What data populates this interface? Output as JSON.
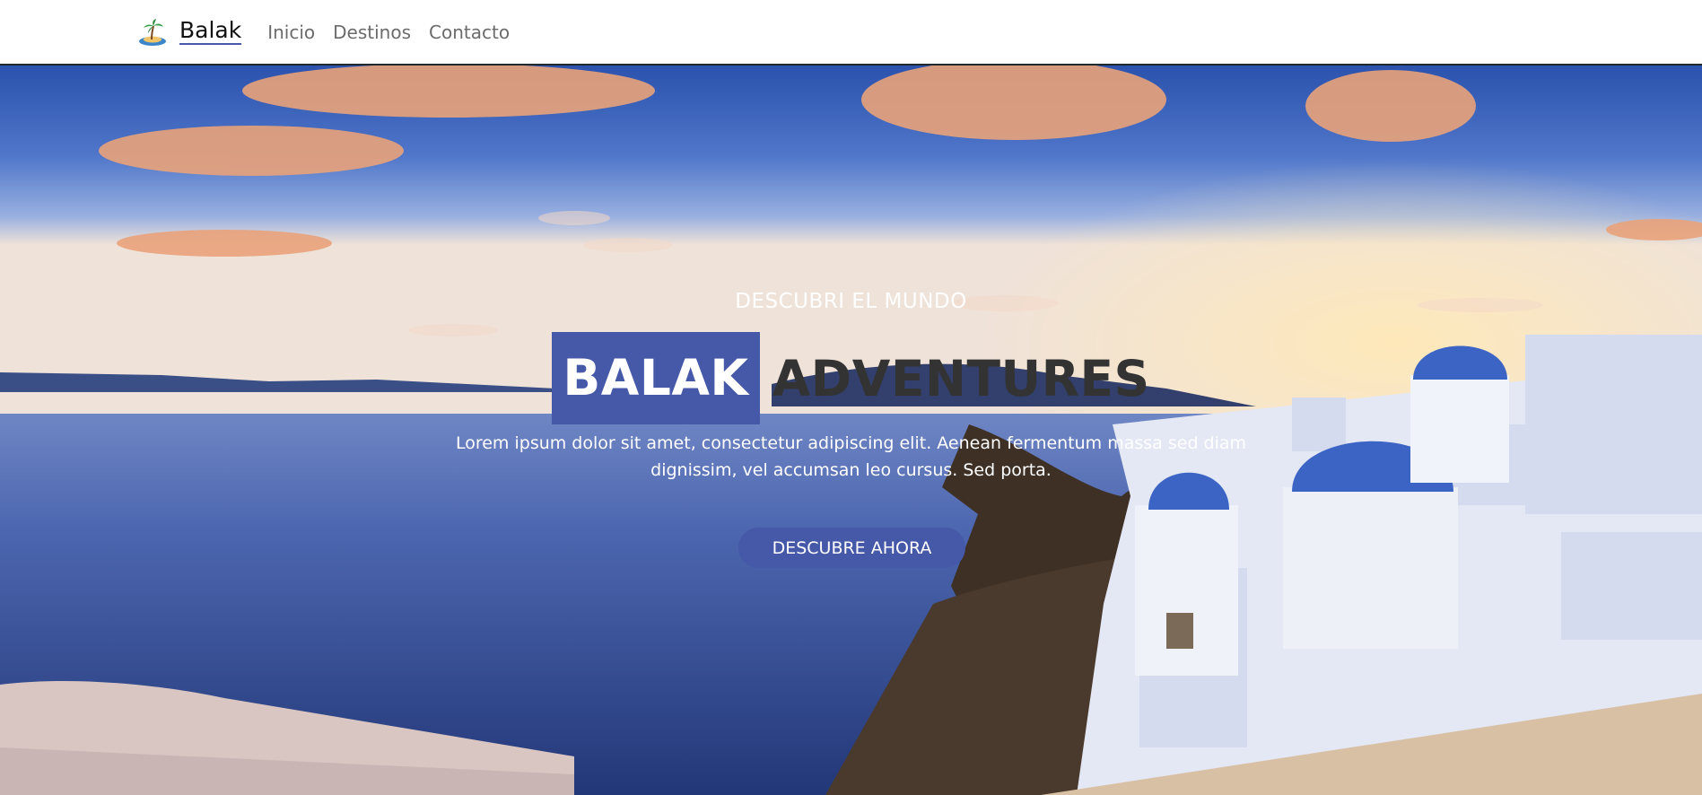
{
  "brand": {
    "name": "Balak",
    "logo_icon": "palm-island-icon"
  },
  "nav": {
    "links": [
      "Inicio",
      "Destinos",
      "Contacto"
    ]
  },
  "hero": {
    "eyebrow": "DESCUBRI EL MUNDO",
    "title_highlight": "BALAK",
    "title_rest": "ADVENTURES",
    "description": "Lorem ipsum dolor sit amet, consectetur adipiscing elit. Aenean fermentum massa sed diam dignissim, vel accumsan leo cursus. Sed porta.",
    "cta_label": "DESCUBRE AHORA",
    "background": "santorini-coast-photo"
  },
  "colors": {
    "accent": "#4658a8",
    "title_dark": "#333333",
    "nav_text": "#6b6b6b"
  }
}
